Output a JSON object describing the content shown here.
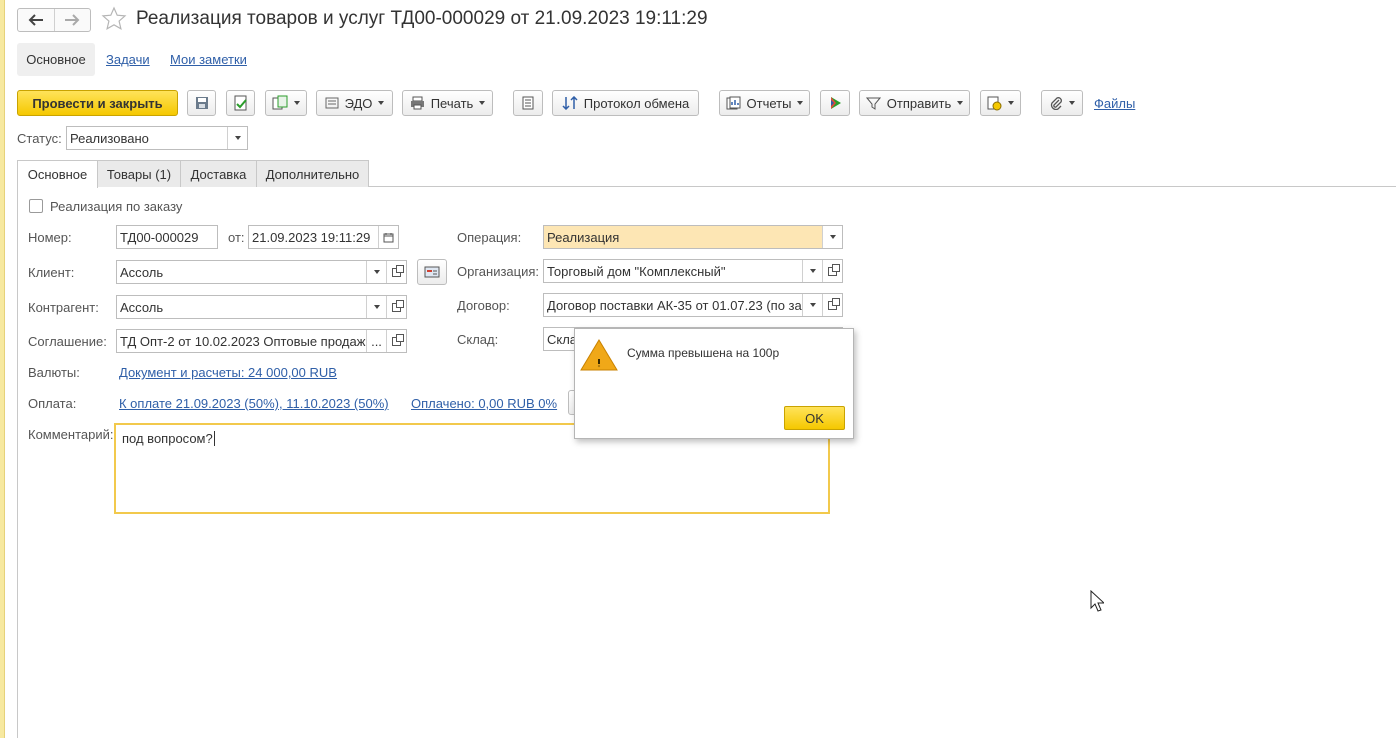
{
  "window": {
    "title": "Реализация товаров и услуг ТД00-000029 от 21.09.2023 19:11:29"
  },
  "top_tabs": {
    "main": "Основное",
    "tasks": "Задачи",
    "notes": "Мои заметки"
  },
  "toolbar": {
    "post_close": "Провести и закрыть",
    "edo": "ЭДО",
    "print": "Печать",
    "protocol": "Протокол обмена",
    "reports": "Отчеты",
    "send": "Отправить",
    "files": "Файлы"
  },
  "status": {
    "label": "Статус:",
    "value": "Реализовано"
  },
  "form_tabs": [
    "Основное",
    "Товары (1)",
    "Доставка",
    "Дополнительно"
  ],
  "form": {
    "by_order_label": "Реализация по заказу",
    "number_label": "Номер:",
    "number_value": "ТД00-000029",
    "from_label": "от:",
    "date_value": "21.09.2023 19:11:29",
    "operation_label": "Операция:",
    "operation_value": "Реализация",
    "client_label": "Клиент:",
    "client_value": "Ассоль",
    "org_label": "Организация:",
    "org_value": "Торговый дом \"Комплексный\"",
    "counterparty_label": "Контрагент:",
    "counterparty_value": "Ассоль",
    "contract_label": "Договор:",
    "contract_value": "Договор поставки АК-35 от 01.07.23 (по за",
    "agreement_label": "Соглашение:",
    "agreement_value": "ТД Опт-2 от 10.02.2023 Оптовые продаж",
    "agreement_more": "...",
    "warehouse_label": "Склад:",
    "warehouse_value": "Скла",
    "currency_label": "Валюты:",
    "currency_link": "Документ и расчеты: 24 000,00 RUB",
    "payment_label": "Оплата:",
    "payment_link": "К оплате 21.09.2023 (50%), 11.10.2023 (50%)",
    "paid_link": "Оплачено: 0,00 RUB 0%",
    "comment_label": "Комментарий:",
    "comment_value": "под вопросом?"
  },
  "dialog": {
    "message": "Сумма превышена на 100р",
    "ok": "OK"
  },
  "colors": {
    "accent_yellow": "#f5c800",
    "link_blue": "#2f5fa8",
    "operation_bg": "#fde6b4"
  }
}
